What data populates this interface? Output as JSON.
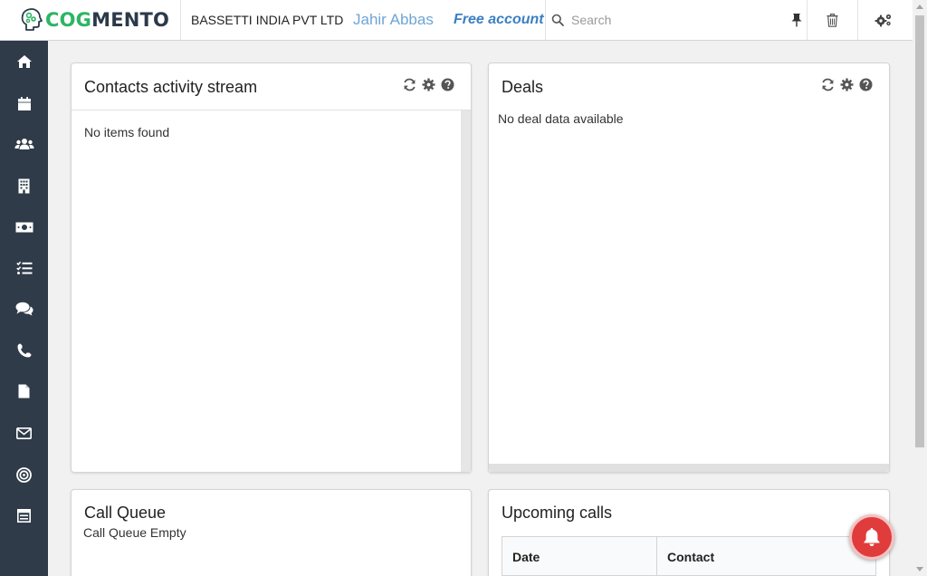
{
  "app": {
    "logo_cog": "COG",
    "logo_mento": "MENTO",
    "company": "BASSETTI INDIA PVT LTD",
    "user_name": "Jahir Abbas",
    "account_type": "Free account"
  },
  "search": {
    "placeholder": "Search",
    "value": ""
  },
  "topbar_icons": [
    "search-icon",
    "pin-icon",
    "trash-icon",
    "settings-icon"
  ],
  "sidebar": {
    "items": [
      {
        "name": "home",
        "icon": "home-icon"
      },
      {
        "name": "calendar",
        "icon": "calendar-icon"
      },
      {
        "name": "contacts",
        "icon": "users-icon"
      },
      {
        "name": "companies",
        "icon": "building-icon"
      },
      {
        "name": "deals",
        "icon": "money-icon"
      },
      {
        "name": "tasks",
        "icon": "tasks-icon"
      },
      {
        "name": "cases",
        "icon": "comments-icon"
      },
      {
        "name": "calls",
        "icon": "phone-icon"
      },
      {
        "name": "documents",
        "icon": "file-icon"
      },
      {
        "name": "email",
        "icon": "envelope-icon"
      },
      {
        "name": "campaigns",
        "icon": "bullseye-icon"
      },
      {
        "name": "forms",
        "icon": "form-icon"
      }
    ]
  },
  "cards": {
    "contacts_activity": {
      "title": "Contacts activity stream",
      "empty": "No items found"
    },
    "deals": {
      "title": "Deals",
      "empty": "No deal data available"
    },
    "call_queue": {
      "title": "Call Queue",
      "empty": "Call Queue Empty"
    },
    "upcoming_calls": {
      "title": "Upcoming calls",
      "columns": [
        "Date",
        "Contact"
      ]
    }
  },
  "colors": {
    "sidebar_bg": "#2f3b49",
    "brand_green": "#2db563",
    "brand_dark": "#2b3a4a",
    "user_blue": "#6fa5d6",
    "account_blue": "#3b7fc4",
    "notification_red": "#e03c3c"
  }
}
